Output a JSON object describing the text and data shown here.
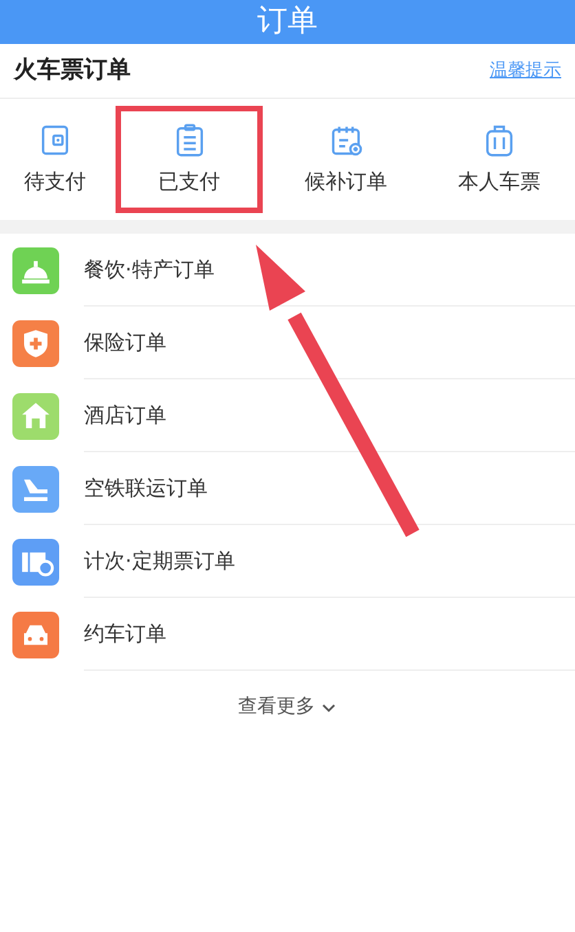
{
  "header": {
    "title": "订单"
  },
  "section": {
    "title": "火车票订单",
    "link": "温馨提示"
  },
  "tabs": [
    {
      "label": "待支付",
      "kind": "wallet",
      "highlighted": false
    },
    {
      "label": "已支付",
      "kind": "clipboard",
      "highlighted": true
    },
    {
      "label": "候补订单",
      "kind": "calendar",
      "highlighted": false
    },
    {
      "label": "本人车票",
      "kind": "luggage",
      "highlighted": false
    }
  ],
  "orders": [
    {
      "label": "餐饮·特产订单",
      "kind": "bell",
      "color": "#6fd254"
    },
    {
      "label": "保险订单",
      "kind": "shield",
      "color": "#f58047"
    },
    {
      "label": "酒店订单",
      "kind": "house",
      "color": "#9ddc6c"
    },
    {
      "label": "空铁联运订单",
      "kind": "plane",
      "color": "#68a9f7"
    },
    {
      "label": "计次·定期票订单",
      "kind": "ticket",
      "color": "#5e9ef5"
    },
    {
      "label": "约车订单",
      "kind": "car",
      "color": "#f57a45"
    }
  ],
  "more": {
    "label": "查看更多"
  }
}
